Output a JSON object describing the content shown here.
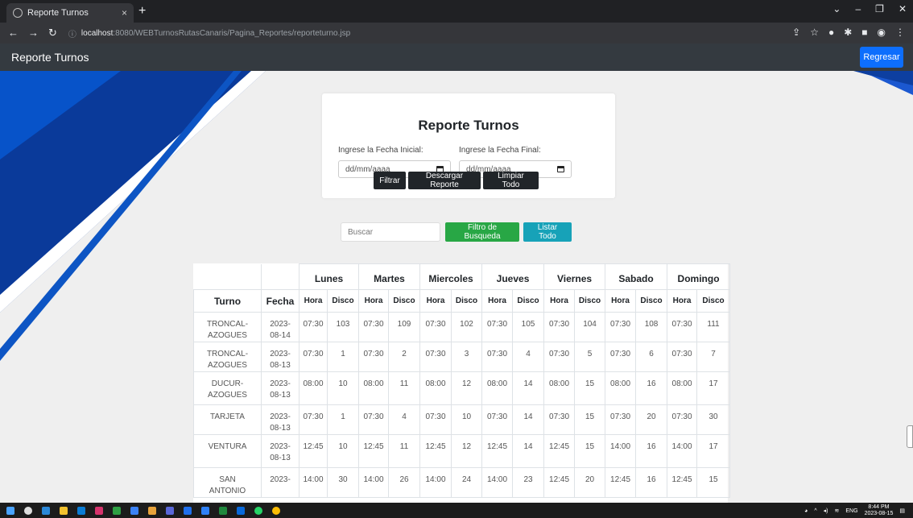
{
  "browser": {
    "tab_title": "Reporte Turnos",
    "url_host": "localhost",
    "url_path": ":8080/WEBTurnosRutasCanaris/Pagina_Reportes/reporteturno.jsp"
  },
  "appbar": {
    "brand": "Reporte Turnos",
    "back_button": "Regresar"
  },
  "filter_card": {
    "title": "Reporte Turnos",
    "start_label": "Ingrese la Fecha Inicial:",
    "end_label": "Ingrese la Fecha Final:",
    "start_placeholder": "dd/mm/aaaa",
    "end_placeholder": "dd/mm/aaaa",
    "filter_button": "Filtrar",
    "download_button": "Descargar Reporte",
    "clear_button": "Limpiar Todo"
  },
  "search": {
    "placeholder": "Buscar",
    "filter_button": "Filtro de Busqueda",
    "list_all_button": "Listar Todo"
  },
  "table": {
    "col_turno": "Turno",
    "col_fecha": "Fecha",
    "days": [
      "Lunes",
      "Martes",
      "Miercoles",
      "Jueves",
      "Viernes",
      "Sabado",
      "Domingo"
    ],
    "sub_hora": "Hora",
    "sub_disco": "Disco",
    "rows": [
      {
        "turno": "TRONCAL-AZOGUES",
        "fecha": "2023-08-14",
        "cells": [
          [
            "07:30",
            "103"
          ],
          [
            "07:30",
            "109"
          ],
          [
            "07:30",
            "102"
          ],
          [
            "07:30",
            "105"
          ],
          [
            "07:30",
            "104"
          ],
          [
            "07:30",
            "108"
          ],
          [
            "07:30",
            "111"
          ]
        ]
      },
      {
        "turno": "TRONCAL-AZOGUES",
        "fecha": "2023-08-13",
        "cells": [
          [
            "07:30",
            "1"
          ],
          [
            "07:30",
            "2"
          ],
          [
            "07:30",
            "3"
          ],
          [
            "07:30",
            "4"
          ],
          [
            "07:30",
            "5"
          ],
          [
            "07:30",
            "6"
          ],
          [
            "07:30",
            "7"
          ]
        ]
      },
      {
        "turno": "DUCUR-AZOGUES",
        "fecha": "2023-08-13",
        "cells": [
          [
            "08:00",
            "10"
          ],
          [
            "08:00",
            "11"
          ],
          [
            "08:00",
            "12"
          ],
          [
            "08:00",
            "14"
          ],
          [
            "08:00",
            "15"
          ],
          [
            "08:00",
            "16"
          ],
          [
            "08:00",
            "17"
          ]
        ]
      },
      {
        "turno": "TARJETA",
        "fecha": "2023-08-13",
        "cells": [
          [
            "07:30",
            "1"
          ],
          [
            "07:30",
            "4"
          ],
          [
            "07:30",
            "10"
          ],
          [
            "07:30",
            "14"
          ],
          [
            "07:30",
            "15"
          ],
          [
            "07:30",
            "20"
          ],
          [
            "07:30",
            "30"
          ]
        ]
      },
      {
        "turno": "VENTURA",
        "fecha": "2023-08-13",
        "cells": [
          [
            "12:45",
            "10"
          ],
          [
            "12:45",
            "11"
          ],
          [
            "12:45",
            "12"
          ],
          [
            "12:45",
            "14"
          ],
          [
            "12:45",
            "15"
          ],
          [
            "14:00",
            "16"
          ],
          [
            "14:00",
            "17"
          ]
        ]
      },
      {
        "turno": "SAN ANTONIO",
        "fecha": "2023-",
        "cells": [
          [
            "14:00",
            "30"
          ],
          [
            "14:00",
            "26"
          ],
          [
            "14:00",
            "24"
          ],
          [
            "14:00",
            "23"
          ],
          [
            "12:45",
            "20"
          ],
          [
            "12:45",
            "16"
          ],
          [
            "12:45",
            "15"
          ]
        ]
      }
    ]
  },
  "taskbar": {
    "language": "ENG",
    "time": "8:44 PM",
    "date": "2023-08-15"
  }
}
